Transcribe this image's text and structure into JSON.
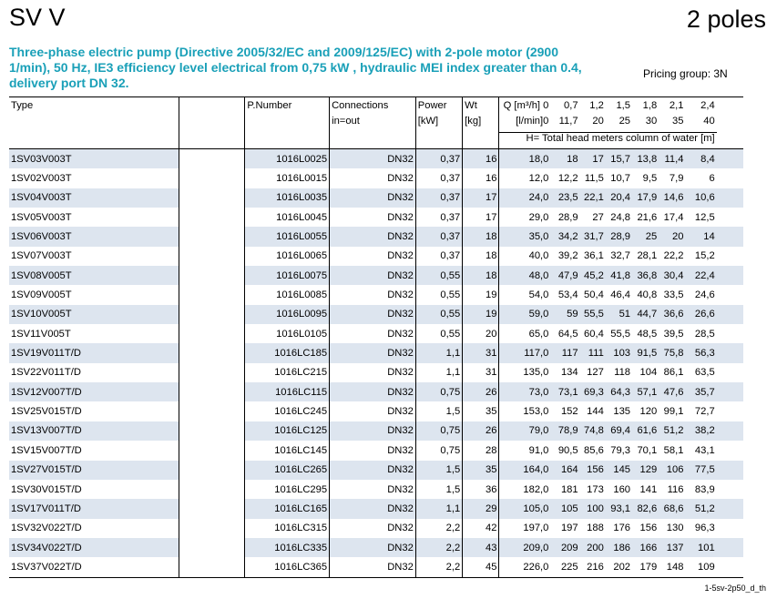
{
  "header": {
    "title": "SV V",
    "poles": "2 poles"
  },
  "subtitle": "Three-phase electric pump (Directive 2005/32/EC and 2009/125/EC) with 2-pole motor (2900 1/min), 50 Hz, IE3 efficiency level electrical from 0,75 kW , hydraulic MEI index greater than 0.4, delivery port  DN 32.",
  "pricing": "Pricing group:  3N",
  "columns": {
    "type": "Type",
    "pnumber": "P.Number",
    "connections": "Connections",
    "connections2": "in=out",
    "power": "Power",
    "power_unit": "[kW]",
    "wt": "Wt",
    "wt_unit": "[kg]",
    "q1": "Q [m³/h]",
    "q2": "[l/min]",
    "head": "H= Total head meters column of water [m]"
  },
  "q_m3h": [
    "0",
    "0,7",
    "1,2",
    "1,5",
    "1,8",
    "2,1",
    "2,4"
  ],
  "q_lmin": [
    "0",
    "11,7",
    "20",
    "25",
    "30",
    "35",
    "40"
  ],
  "rows": [
    {
      "type": "1SV03V003T",
      "pn": "1016L0025",
      "conn": "DN32",
      "pw": "0,37",
      "wt": "16",
      "h": [
        "18,0",
        "18",
        "17",
        "15,7",
        "13,8",
        "11,4",
        "8,4"
      ]
    },
    {
      "type": "1SV02V003T",
      "pn": "1016L0015",
      "conn": "DN32",
      "pw": "0,37",
      "wt": "16",
      "h": [
        "12,0",
        "12,2",
        "11,5",
        "10,7",
        "9,5",
        "7,9",
        "6"
      ]
    },
    {
      "type": "1SV04V003T",
      "pn": "1016L0035",
      "conn": "DN32",
      "pw": "0,37",
      "wt": "17",
      "h": [
        "24,0",
        "23,5",
        "22,1",
        "20,4",
        "17,9",
        "14,6",
        "10,6"
      ]
    },
    {
      "type": "1SV05V003T",
      "pn": "1016L0045",
      "conn": "DN32",
      "pw": "0,37",
      "wt": "17",
      "h": [
        "29,0",
        "28,9",
        "27",
        "24,8",
        "21,6",
        "17,4",
        "12,5"
      ]
    },
    {
      "type": "1SV06V003T",
      "pn": "1016L0055",
      "conn": "DN32",
      "pw": "0,37",
      "wt": "18",
      "h": [
        "35,0",
        "34,2",
        "31,7",
        "28,9",
        "25",
        "20",
        "14"
      ]
    },
    {
      "type": "1SV07V003T",
      "pn": "1016L0065",
      "conn": "DN32",
      "pw": "0,37",
      "wt": "18",
      "h": [
        "40,0",
        "39,2",
        "36,1",
        "32,7",
        "28,1",
        "22,2",
        "15,2"
      ]
    },
    {
      "type": "1SV08V005T",
      "pn": "1016L0075",
      "conn": "DN32",
      "pw": "0,55",
      "wt": "18",
      "h": [
        "48,0",
        "47,9",
        "45,2",
        "41,8",
        "36,8",
        "30,4",
        "22,4"
      ]
    },
    {
      "type": "1SV09V005T",
      "pn": "1016L0085",
      "conn": "DN32",
      "pw": "0,55",
      "wt": "19",
      "h": [
        "54,0",
        "53,4",
        "50,4",
        "46,4",
        "40,8",
        "33,5",
        "24,6"
      ]
    },
    {
      "type": "1SV10V005T",
      "pn": "1016L0095",
      "conn": "DN32",
      "pw": "0,55",
      "wt": "19",
      "h": [
        "59,0",
        "59",
        "55,5",
        "51",
        "44,7",
        "36,6",
        "26,6"
      ]
    },
    {
      "type": "1SV11V005T",
      "pn": "1016L0105",
      "conn": "DN32",
      "pw": "0,55",
      "wt": "20",
      "h": [
        "65,0",
        "64,5",
        "60,4",
        "55,5",
        "48,5",
        "39,5",
        "28,5"
      ]
    },
    {
      "type": "1SV19V011T/D",
      "pn": "1016LC185",
      "conn": "DN32",
      "pw": "1,1",
      "wt": "31",
      "h": [
        "117,0",
        "117",
        "111",
        "103",
        "91,5",
        "75,8",
        "56,3"
      ]
    },
    {
      "type": "1SV22V011T/D",
      "pn": "1016LC215",
      "conn": "DN32",
      "pw": "1,1",
      "wt": "31",
      "h": [
        "135,0",
        "134",
        "127",
        "118",
        "104",
        "86,1",
        "63,5"
      ]
    },
    {
      "type": "1SV12V007T/D",
      "pn": "1016LC115",
      "conn": "DN32",
      "pw": "0,75",
      "wt": "26",
      "h": [
        "73,0",
        "73,1",
        "69,3",
        "64,3",
        "57,1",
        "47,6",
        "35,7"
      ]
    },
    {
      "type": "1SV25V015T/D",
      "pn": "1016LC245",
      "conn": "DN32",
      "pw": "1,5",
      "wt": "35",
      "h": [
        "153,0",
        "152",
        "144",
        "135",
        "120",
        "99,1",
        "72,7"
      ]
    },
    {
      "type": "1SV13V007T/D",
      "pn": "1016LC125",
      "conn": "DN32",
      "pw": "0,75",
      "wt": "26",
      "h": [
        "79,0",
        "78,9",
        "74,8",
        "69,4",
        "61,6",
        "51,2",
        "38,2"
      ]
    },
    {
      "type": "1SV15V007T/D",
      "pn": "1016LC145",
      "conn": "DN32",
      "pw": "0,75",
      "wt": "28",
      "h": [
        "91,0",
        "90,5",
        "85,6",
        "79,3",
        "70,1",
        "58,1",
        "43,1"
      ]
    },
    {
      "type": "1SV27V015T/D",
      "pn": "1016LC265",
      "conn": "DN32",
      "pw": "1,5",
      "wt": "35",
      "h": [
        "164,0",
        "164",
        "156",
        "145",
        "129",
        "106",
        "77,5"
      ]
    },
    {
      "type": "1SV30V015T/D",
      "pn": "1016LC295",
      "conn": "DN32",
      "pw": "1,5",
      "wt": "36",
      "h": [
        "182,0",
        "181",
        "173",
        "160",
        "141",
        "116",
        "83,9"
      ]
    },
    {
      "type": "1SV17V011T/D",
      "pn": "1016LC165",
      "conn": "DN32",
      "pw": "1,1",
      "wt": "29",
      "h": [
        "105,0",
        "105",
        "100",
        "93,1",
        "82,6",
        "68,6",
        "51,2"
      ]
    },
    {
      "type": "1SV32V022T/D",
      "pn": "1016LC315",
      "conn": "DN32",
      "pw": "2,2",
      "wt": "42",
      "h": [
        "197,0",
        "197",
        "188",
        "176",
        "156",
        "130",
        "96,3"
      ]
    },
    {
      "type": "1SV34V022T/D",
      "pn": "1016LC335",
      "conn": "DN32",
      "pw": "2,2",
      "wt": "43",
      "h": [
        "209,0",
        "209",
        "200",
        "186",
        "166",
        "137",
        "101"
      ]
    },
    {
      "type": "1SV37V022T/D",
      "pn": "1016LC365",
      "conn": "DN32",
      "pw": "2,2",
      "wt": "45",
      "h": [
        "226,0",
        "225",
        "216",
        "202",
        "179",
        "148",
        "109"
      ]
    }
  ],
  "footer": "1-5sv-2p50_d_th"
}
